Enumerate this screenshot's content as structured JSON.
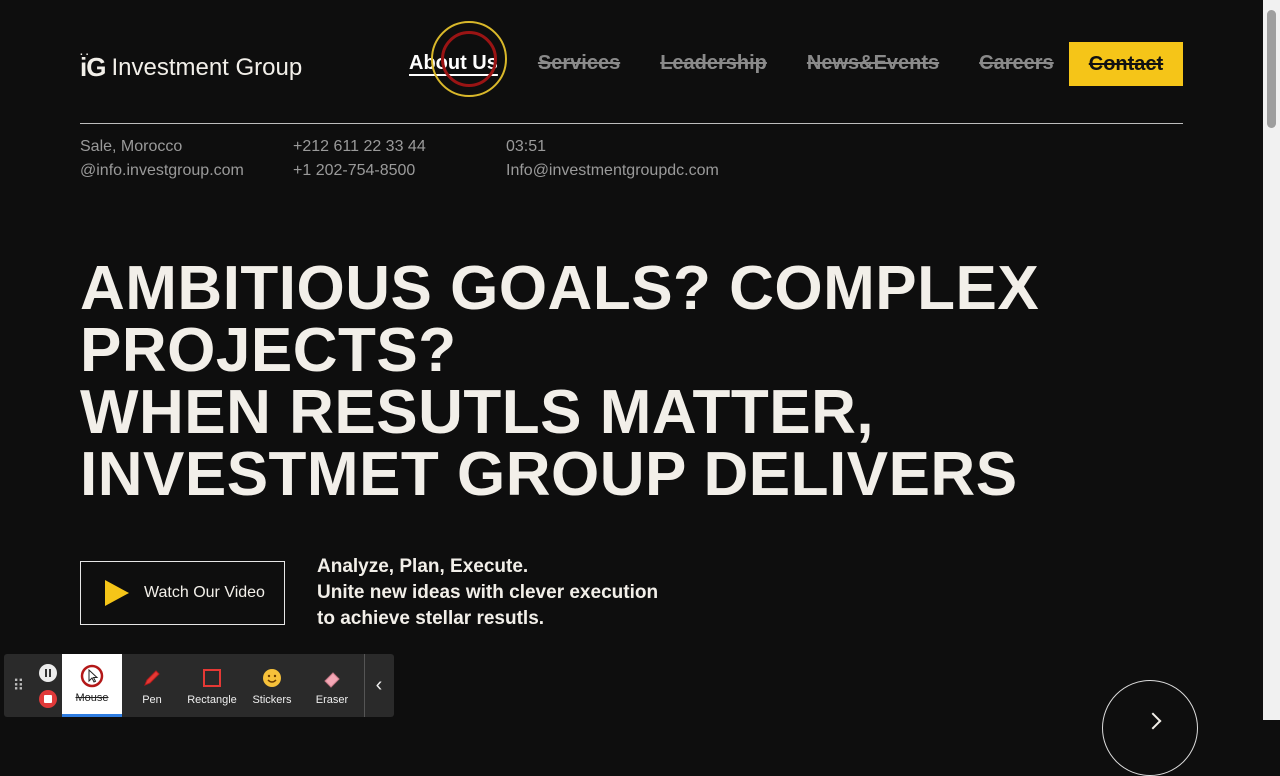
{
  "logo": {
    "mark": "iG",
    "name": "Investment Group"
  },
  "nav": {
    "items": [
      "About Us",
      "Services",
      "Leadership",
      "News&Events",
      "Careers"
    ],
    "contact": "Contact"
  },
  "info": {
    "col1": [
      "Sale, Morocco",
      "@info.investgroup.com"
    ],
    "col2": [
      "+212 611 22 33 44",
      "+1 202-754-8500"
    ],
    "col3": [
      "03:51",
      "Info@investmentgroupdc.com"
    ]
  },
  "hero": {
    "lines": [
      "AMBITIOUS GOALS? COMPLEX",
      "PROJECTS?",
      "WHEN RESUTLS MATTER,",
      "INVESTMET GROUP DELIVERS"
    ]
  },
  "video": {
    "label": "Watch Our Video"
  },
  "tagline": {
    "lines": [
      "Analyze, Plan, Execute.",
      "Unite new ideas with clever execution",
      "to achieve stellar resutls."
    ]
  },
  "toolbar": {
    "tools": [
      "Mouse",
      "Pen",
      "Rectangle",
      "Stickers",
      "Eraser"
    ]
  },
  "colors": {
    "accent": "#f5c518",
    "background": "#0e0e0e",
    "text": "#f2efe9"
  }
}
